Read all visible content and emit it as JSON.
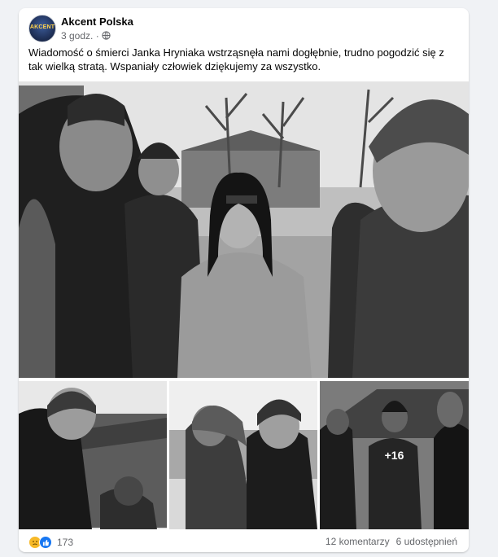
{
  "post": {
    "author": "Akcent Polska",
    "avatar_text": "AKCENT",
    "time": "3 godz.",
    "separator": "·",
    "text": "Wiadomość o śmierci Janka Hryniaka wstrząsnęła nami dogłębnie, trudno pogodzić się z tak wielką stratą. Wspaniały człowiek dziękujemy za wszystko."
  },
  "photos": {
    "more_count": "+16"
  },
  "footer": {
    "reaction_icons": [
      "sad-reaction-icon",
      "like-reaction-icon"
    ],
    "reaction_count": "173",
    "comments": "12 komentarzy",
    "shares": "6 udostępnień"
  }
}
